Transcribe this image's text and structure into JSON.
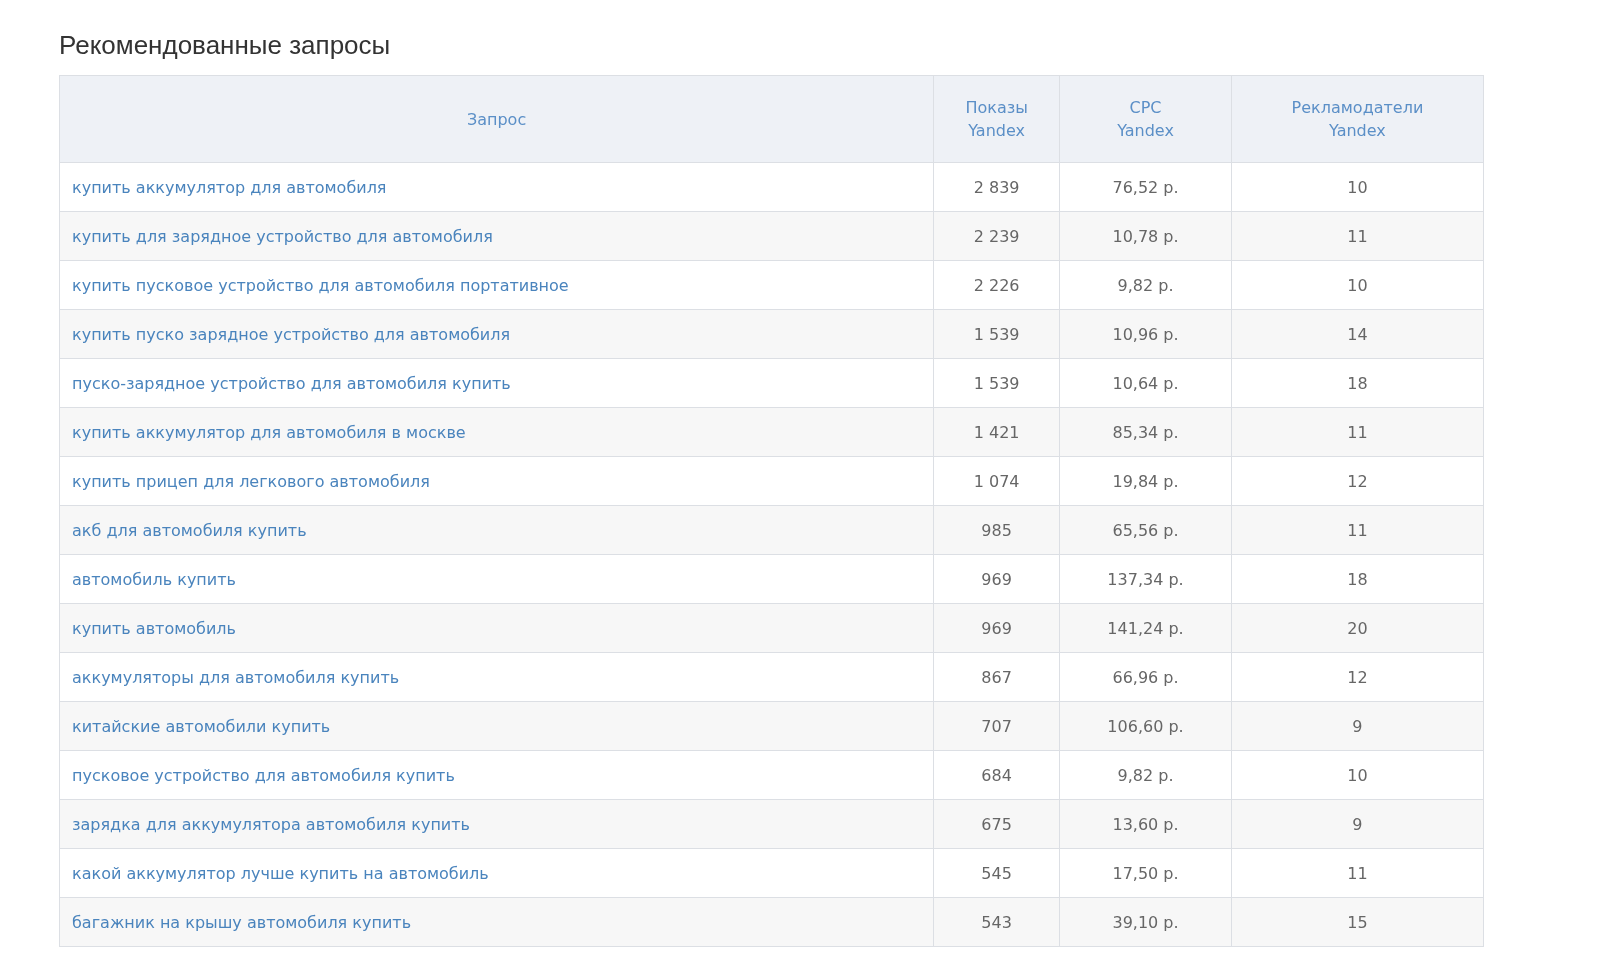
{
  "title": "Рекомендованные запросы",
  "table": {
    "columns": [
      "Запрос",
      "Показы Yandex",
      "CPC Yandex",
      "Рекламодатели Yandex"
    ],
    "rows": [
      [
        "купить аккумулятор для автомобиля",
        "2 839",
        "76,52 р.",
        "10"
      ],
      [
        "купить для зарядное устройство для автомобиля",
        "2 239",
        "10,78 р.",
        "11"
      ],
      [
        "купить пусковое устройство для автомобиля портативное",
        "2 226",
        "9,82 р.",
        "10"
      ],
      [
        "купить пуско зарядное устройство для автомобиля",
        "1 539",
        "10,96 р.",
        "14"
      ],
      [
        "пуско-зарядное устройство для автомобиля купить",
        "1 539",
        "10,64 р.",
        "18"
      ],
      [
        "купить аккумулятор для автомобиля в москве",
        "1 421",
        "85,34 р.",
        "11"
      ],
      [
        "купить прицеп для легкового автомобиля",
        "1 074",
        "19,84 р.",
        "12"
      ],
      [
        "акб для автомобиля купить",
        "985",
        "65,56 р.",
        "11"
      ],
      [
        "автомобиль купить",
        "969",
        "137,34 р.",
        "18"
      ],
      [
        "купить автомобиль",
        "969",
        "141,24 р.",
        "20"
      ],
      [
        "аккумуляторы для автомобиля купить",
        "867",
        "66,96 р.",
        "12"
      ],
      [
        "китайские автомобили купить",
        "707",
        "106,60 р.",
        "9"
      ],
      [
        "пусковое устройство для автомобиля купить",
        "684",
        "9,82 р.",
        "10"
      ],
      [
        "зарядка для аккумулятора автомобиля купить",
        "675",
        "13,60 р.",
        "9"
      ],
      [
        "какой аккумулятор лучше купить на автомобиль",
        "545",
        "17,50 р.",
        "11"
      ],
      [
        "багажник на крышу автомобиля купить",
        "543",
        "39,10 р.",
        "15"
      ]
    ]
  }
}
